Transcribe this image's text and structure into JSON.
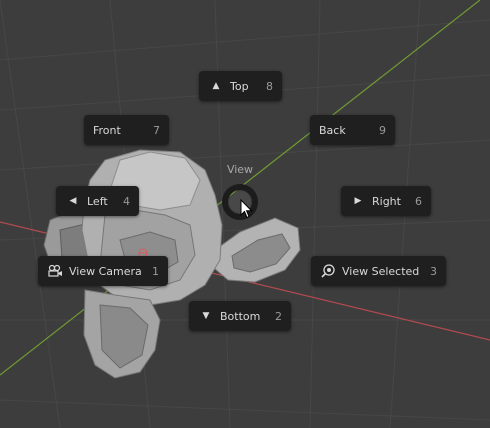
{
  "pie_menu": {
    "title": "View",
    "items": {
      "top": {
        "label": "Top",
        "shortcut": "8",
        "icon": "triangle-up-icon"
      },
      "front": {
        "label": "Front",
        "shortcut": "7"
      },
      "back": {
        "label": "Back",
        "shortcut": "9"
      },
      "left": {
        "label": "Left",
        "shortcut": "4",
        "icon": "triangle-left-icon"
      },
      "right": {
        "label": "Right",
        "shortcut": "6",
        "icon": "triangle-right-icon"
      },
      "view_camera": {
        "label": "View Camera",
        "shortcut": "1",
        "icon": "camera-icon"
      },
      "view_selected": {
        "label": "View Selected",
        "shortcut": "3",
        "icon": "zoom-selected-icon"
      },
      "bottom": {
        "label": "Bottom",
        "shortcut": "2",
        "icon": "triangle-down-icon"
      }
    }
  },
  "colors": {
    "viewport_bg": "#3d3d3d",
    "grid": "#474747",
    "x_axis": "#b34a4f",
    "y_axis": "#6f9a32",
    "button_bg": "#1f1f1f",
    "text": "#d9d9d9",
    "shortcut": "#9a9a9a"
  }
}
